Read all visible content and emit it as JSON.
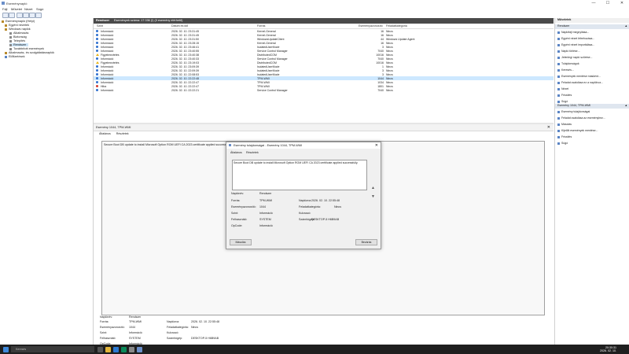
{
  "window": {
    "title": "Eseménynapló",
    "min": "—",
    "max": "☐",
    "close": "✕"
  },
  "menu": [
    "Fájl",
    "Művelet",
    "Nézet",
    "Súgó"
  ],
  "tree": [
    {
      "label": "Eseménynapló (Helyi)",
      "level": 0
    },
    {
      "label": "Egyéni nézetek",
      "level": 1
    },
    {
      "label": "Windows naplók",
      "level": 1
    },
    {
      "label": "Alkalmazás",
      "level": 2
    },
    {
      "label": "Biztonság",
      "level": 2
    },
    {
      "label": "Telepítés",
      "level": 2
    },
    {
      "label": "Rendszer",
      "level": 2,
      "selected": true
    },
    {
      "label": "Továbbított események",
      "level": 2
    },
    {
      "label": "Alkalmazás- és szolgáltatásnaplók",
      "level": 1
    },
    {
      "label": "Előfizetések",
      "level": 1
    }
  ],
  "list": {
    "header_title": "Rendszer",
    "header_info": "Események száma: 17 036 (!) (3 esemény elérhető)",
    "columns": [
      "Szint",
      "Dátum és idő",
      "Forrás",
      "Eseményazonosító",
      "Feladatkategória"
    ],
    "rows": [
      {
        "level": "Információ",
        "icon": "info",
        "date": "2026. 02. 10. 23:31:45",
        "source": "Kernel-General",
        "id": "16",
        "cat": "Nincs"
      },
      {
        "level": "Információ",
        "icon": "info",
        "date": "2026. 02. 10. 23:31:45",
        "source": "Kernel-General",
        "id": "16",
        "cat": "Nincs"
      },
      {
        "level": "Információ",
        "icon": "info",
        "date": "2026. 02. 10. 23:31:50",
        "source": "WindowsUpdateClient",
        "id": "44",
        "cat": "Windows Update Agent"
      },
      {
        "level": "Információ",
        "icon": "info",
        "date": "2026. 02. 10. 23:28:15",
        "source": "Kernel-General",
        "id": "16",
        "cat": "Nincs"
      },
      {
        "level": "Információ",
        "icon": "info",
        "date": "2026. 02. 10. 23:46:41",
        "source": "IsolatedUserMode",
        "id": "3",
        "cat": "Nincs"
      },
      {
        "level": "Információ",
        "icon": "info",
        "date": "2026. 02. 10. 23:40:55",
        "source": "Service Control Manager",
        "id": "7040",
        "cat": "Nincs"
      },
      {
        "level": "Figyelmeztetés",
        "icon": "warn",
        "date": "2026. 02. 10. 23:40:38",
        "source": "DistributedCOM",
        "id": "10016",
        "cat": "Nincs"
      },
      {
        "level": "Információ",
        "icon": "info",
        "date": "2026. 02. 10. 23:40:33",
        "source": "Service Control Manager",
        "id": "7040",
        "cat": "Nincs"
      },
      {
        "level": "Figyelmeztetés",
        "icon": "warn",
        "date": "2026. 02. 10. 23:19:03",
        "source": "DistributedCOM",
        "id": "10016",
        "cat": "Nincs"
      },
      {
        "level": "Információ",
        "icon": "info",
        "date": "2026. 02. 10. 23:09:39",
        "source": "IsolatedUserMode",
        "id": "1",
        "cat": "Nincs"
      },
      {
        "level": "Információ",
        "icon": "info",
        "date": "2026. 02. 10. 22:09:39",
        "source": "IsolatedUserMode",
        "id": "3",
        "cat": "Nincs"
      },
      {
        "level": "Információ",
        "icon": "info",
        "date": "2026. 02. 10. 22:08:53",
        "source": "IsolatedUserMode",
        "id": "3",
        "cat": "Nincs"
      },
      {
        "level": "Információ",
        "icon": "info",
        "date": "2026. 02. 10. 22:22:48",
        "source": "TPM-WMI",
        "id": "1044",
        "cat": "Nincs",
        "selected": true
      },
      {
        "level": "Információ",
        "icon": "info",
        "date": "2026. 02. 10. 22:22:47",
        "source": "TPM-WMI",
        "id": "1034",
        "cat": "Nincs"
      },
      {
        "level": "Hiba",
        "icon": "err",
        "date": "2026. 02. 10. 22:22:47",
        "source": "TPM-WMI",
        "id": "1801",
        "cat": "Nincs"
      },
      {
        "level": "Információ",
        "icon": "info",
        "date": "2026. 02. 10. 22:22:21",
        "source": "Service Control Manager",
        "id": "7040",
        "cat": "Nincs"
      }
    ]
  },
  "detail": {
    "header": "Esemény 1044, TPM-WMI",
    "tabs": [
      "Általános",
      "Részletek"
    ],
    "message": "Secure Boot DB update to install Microsoft Option ROM UEFI CA 2023 certificate applied successfully.",
    "fields": {
      "naplonev_label": "Naplónév:",
      "naplonev": "Rendszer",
      "forras_label": "Forrás:",
      "forras": "TPM-WMI",
      "naplozva_label": "Naplózva:",
      "naplozva": "2026. 02. 10. 22:55:48",
      "esemenyazon_label": "Eseményazonosító:",
      "esemenyazon": "1044",
      "feladatkat_label": "Feladatkategória:",
      "feladatkat": "Nincs",
      "szint_label": "Szint:",
      "szint": "Információ",
      "kulcsszo_label": "Kulcsszó:",
      "kulcsszo": "",
      "felhasznalo_label": "Felhasználó:",
      "felhasznalo": "SYSTEM",
      "szamitogep_label": "Számítógép:",
      "szamitogep": "DESKTOP-5 H6B9AB",
      "opcode_label": "OpCode:",
      "opcode": "Információ"
    }
  },
  "dialog": {
    "title": "Esemény tulajdonságai - Esemény 1044, TPM-WMI",
    "tabs": [
      "Általános",
      "Részletek"
    ],
    "message": "Secure Boot DB update to install Microsoft Option ROM UEFI CA 2023 certificate applied successfully.",
    "copy_button": "Másolás",
    "close_button": "Bezárás"
  },
  "actions": {
    "title": "Műveletek",
    "section1": "Rendszer",
    "items1": [
      "Naplófájl megnyitása...",
      "Egyéni nézet létrehozása...",
      "Egyéni nézet importálása...",
      "Napló törlése...",
      "Jelenlegi napló szűrése...",
      "Tulajdonságok",
      "Keresés...",
      "Események mentése másként...",
      "Feladat csatolása ez a naplóhoz...",
      "Nézet",
      "Frissítés",
      "Súgó"
    ],
    "section2": "Esemény 1044, TPM-WMI",
    "items2": [
      "Esemény tulajdonságai",
      "Feladat csatolása az eseményhez...",
      "Másolás",
      "Kijelölt események mentése...",
      "Frissítés",
      "Súgó"
    ]
  },
  "taskbar": {
    "search": "Keresés",
    "time": "20:30:31",
    "date": "2026. 02. 10."
  }
}
